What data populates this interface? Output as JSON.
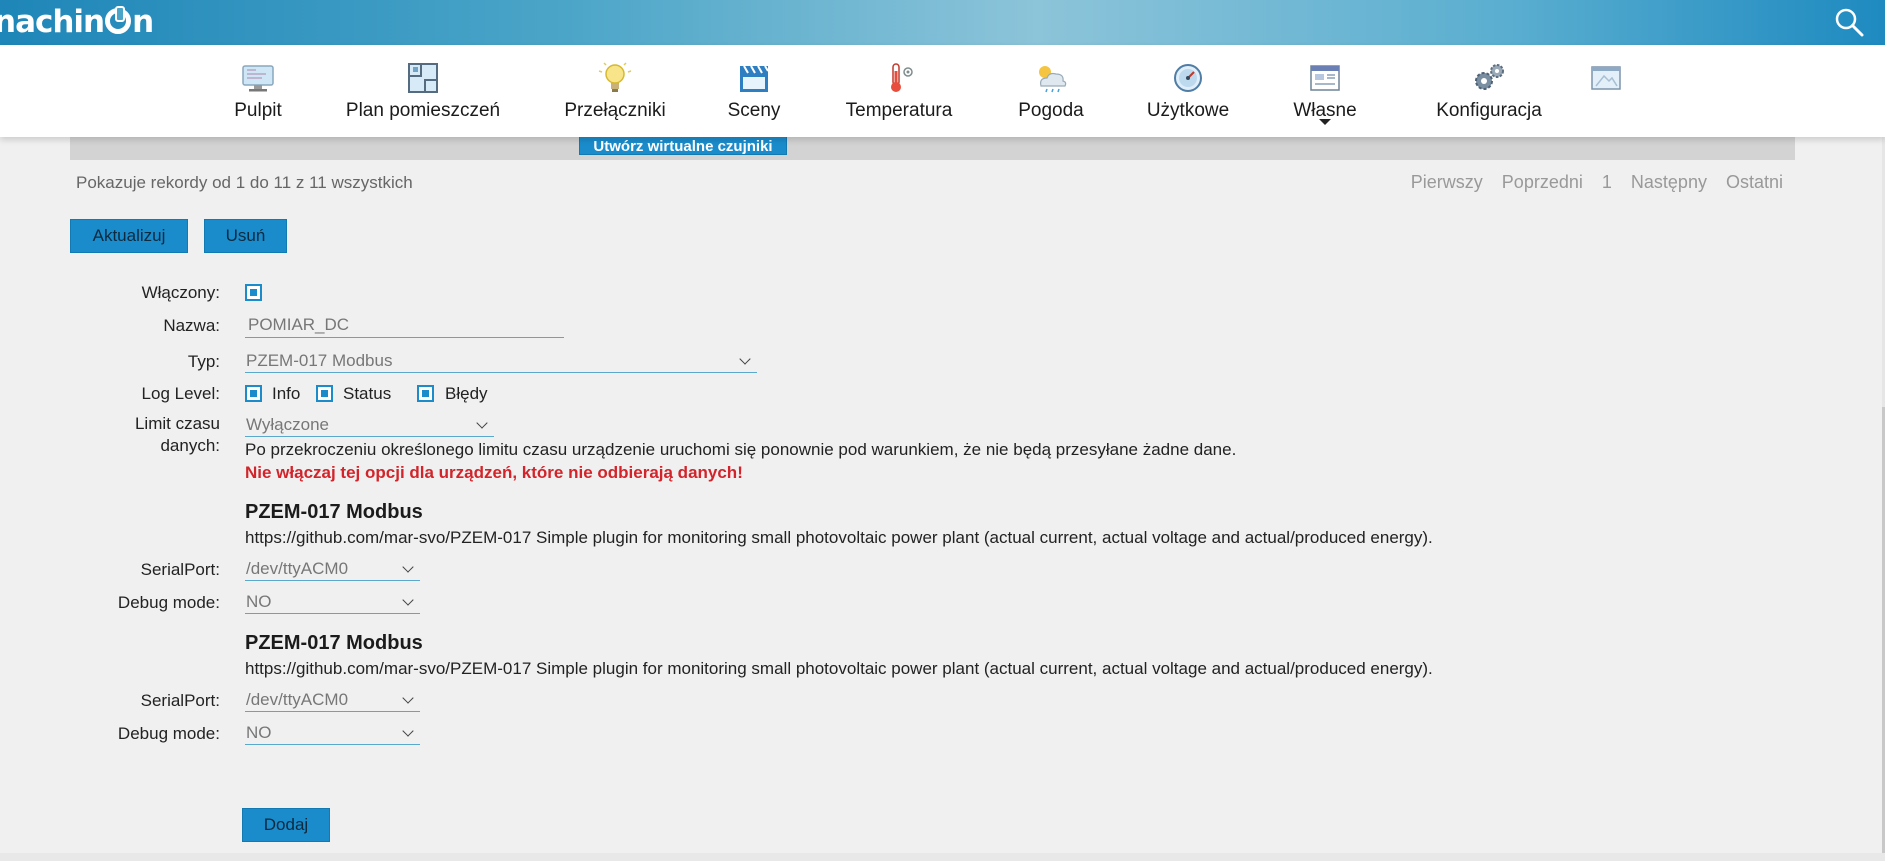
{
  "header": {
    "logo_text_start": "nachin",
    "logo_text_end": "n"
  },
  "nav": {
    "items": [
      {
        "label": "Pulpit",
        "icon": "desktop-icon"
      },
      {
        "label": "Plan pomieszczeń",
        "icon": "floorplan-icon"
      },
      {
        "label": "Przełączniki",
        "icon": "lightbulb-icon"
      },
      {
        "label": "Sceny",
        "icon": "clapperboard-icon"
      },
      {
        "label": "Temperatura",
        "icon": "thermometer-icon"
      },
      {
        "label": "Pogoda",
        "icon": "weather-icon"
      },
      {
        "label": "Użytkowe",
        "icon": "gauge-icon"
      },
      {
        "label": "Własne",
        "icon": "custom-window-icon"
      },
      {
        "label": "Konfiguracja",
        "icon": "gears-icon"
      },
      {
        "label": "",
        "icon": "window-icon"
      }
    ]
  },
  "table": {
    "virtual_sensors_button": "Utwórz wirtualne czujniki",
    "records_info": "Pokazuje rekordy od 1 do 11 z 11 wszystkich",
    "pager": {
      "first": "Pierwszy",
      "previous": "Poprzedni",
      "page": "1",
      "next": "Następny",
      "last": "Ostatni"
    }
  },
  "actions": {
    "update": "Aktualizuj",
    "delete": "Usuń",
    "add": "Dodaj"
  },
  "form": {
    "enabled_label": "Włączony:",
    "name_label": "Nazwa:",
    "name_value": "POMIAR_DC",
    "type_label": "Typ:",
    "type_value": "PZEM-017 Modbus",
    "log_level_label": "Log Level:",
    "log_info": "Info",
    "log_status": "Status",
    "log_errors": "Błędy",
    "timeout_label_1": "Limit czasu",
    "timeout_label_2": "danych:",
    "timeout_value": "Wyłączone",
    "timeout_help": "Po przekroczeniu określonego limitu czasu urządzenie uruchomi się ponownie pod warunkiem, że nie będą przesyłane żadne dane.",
    "timeout_warning": "Nie włączaj tej opcji dla urządzeń, które nie odbierają danych!",
    "plugins": [
      {
        "title": "PZEM-017 Modbus",
        "description": "https://github.com/mar-svo/PZEM-017 Simple plugin for monitoring small photovoltaic power plant (actual current, actual voltage and actual/produced energy).",
        "serial_label": "SerialPort:",
        "serial_value": "/dev/ttyACM0",
        "debug_label": "Debug mode:",
        "debug_value": "NO"
      },
      {
        "title": "PZEM-017 Modbus",
        "description": "https://github.com/mar-svo/PZEM-017 Simple plugin for monitoring small photovoltaic power plant (actual current, actual voltage and actual/produced energy).",
        "serial_label": "SerialPort:",
        "serial_value": "/dev/ttyACM0",
        "debug_label": "Debug mode:",
        "debug_value": "NO"
      }
    ]
  },
  "colors": {
    "accent": "#1a8ccc",
    "warning": "#d2242a",
    "background": "#f0f0f0"
  }
}
